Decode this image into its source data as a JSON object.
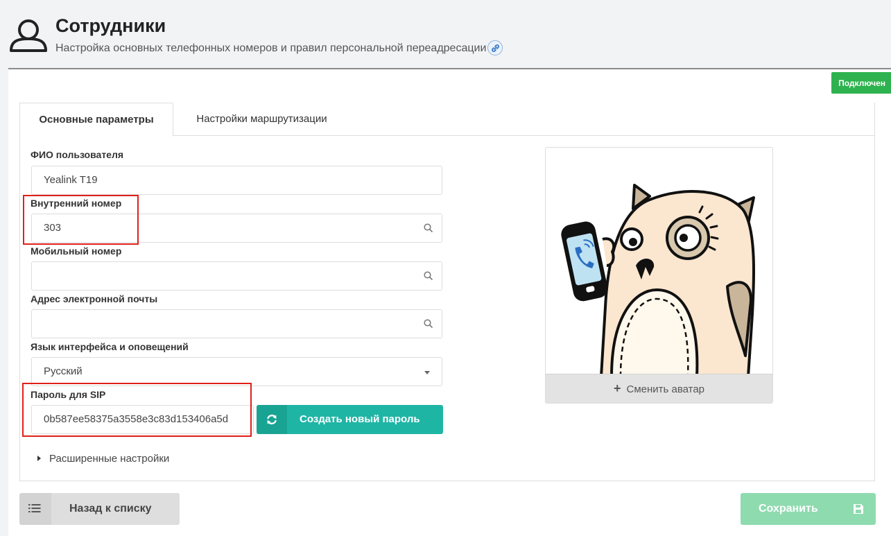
{
  "header": {
    "title": "Сотрудники",
    "subtitle": "Настройка основных телефонных номеров и правил персональной переадресации"
  },
  "status": {
    "badge": "Подключен",
    "color": "#2eb24f"
  },
  "tabs": [
    {
      "label": "Основные параметры",
      "active": true
    },
    {
      "label": "Настройки маршрутизации",
      "active": false
    }
  ],
  "form": {
    "full_name": {
      "label": "ФИО пользователя",
      "value": "Yealink T19"
    },
    "extension": {
      "label": "Внутренний номер",
      "value": "303"
    },
    "mobile": {
      "label": "Мобильный номер",
      "value": ""
    },
    "email": {
      "label": "Адрес электронной почты",
      "value": ""
    },
    "language": {
      "label": "Язык интерфейса и оповещений",
      "value": "Русский"
    },
    "sip_password": {
      "label": "Пароль для SIP",
      "value": "0b587ee58375a3558e3c83d153406a5d"
    },
    "generate_button": "Создать новый пароль",
    "advanced": "Расширенные настройки"
  },
  "avatar": {
    "change_label": "Сменить аватар",
    "image": "owl-holding-phone-illustration"
  },
  "footer": {
    "back_label": "Назад к списку",
    "save_label": "Сохранить"
  },
  "colors": {
    "accent": "#1fb5a5",
    "save": "#8fdbb0",
    "highlight": "#e0201a"
  }
}
